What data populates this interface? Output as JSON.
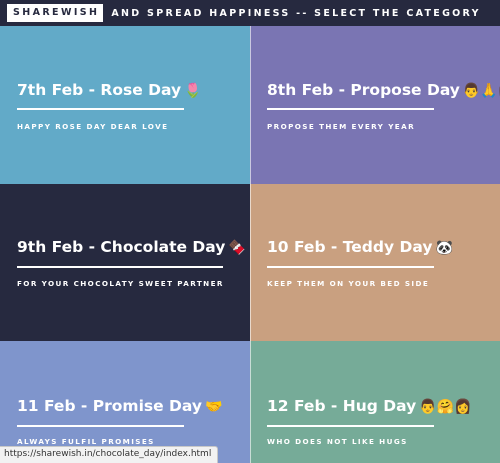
{
  "header": {
    "brand": "SHAREWISH",
    "tagline": "AND SPREAD HAPPINESS -- SELECT THE CATEGORY"
  },
  "tiles": [
    {
      "title": "7th Feb - Rose Day",
      "emoji": "🌷",
      "subtitle": "HAPPY ROSE DAY DEAR LOVE",
      "color": "#62aac8"
    },
    {
      "title": "8th Feb - Propose Day",
      "emoji": "👨🙏👩",
      "subtitle": "PROPOSE THEM EVERY YEAR",
      "color": "#7a75b3"
    },
    {
      "title": "9th Feb - Chocolate Day",
      "emoji": "🍫",
      "subtitle": "FOR YOUR CHOCOLATY SWEET PARTNER",
      "color": "#26293f"
    },
    {
      "title": "10 Feb - Teddy Day",
      "emoji": "🐼",
      "subtitle": "KEEP THEM ON YOUR BED SIDE",
      "color": "#c9a080"
    },
    {
      "title": "11 Feb - Promise Day",
      "emoji": "🤝",
      "subtitle": "ALWAYS FULFIL PROMISES",
      "color": "#7f95cc"
    },
    {
      "title": "12 Feb - Hug Day",
      "emoji": "👨🤗👩",
      "subtitle": "WHO DOES NOT LIKE HUGS",
      "color": "#76ab98"
    }
  ],
  "status_url": "https://sharewish.in/chocolate_day/index.html"
}
